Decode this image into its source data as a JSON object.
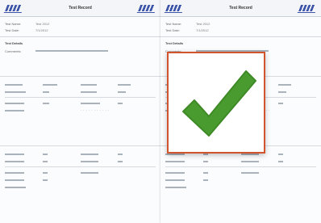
{
  "document": {
    "title": "Test Record",
    "fields": [
      {
        "label": "Test Name:",
        "value": "Test 2012"
      },
      {
        "label": "Test Date:",
        "value": "7/1/2012"
      }
    ],
    "sections": {
      "details": "Test Details",
      "comments": "Comments:",
      "summary": "Summary:"
    }
  },
  "overlay": {
    "icon": "checkmark-icon",
    "border_color": "#d2542c",
    "check_color": "#4a9b2f"
  }
}
